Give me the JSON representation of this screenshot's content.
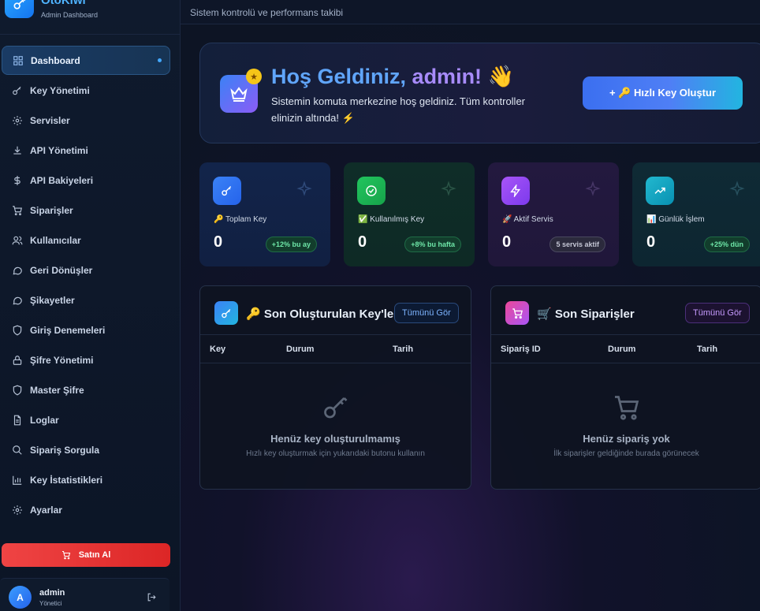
{
  "brand": {
    "name": "OtoKiwi",
    "subtitle": "Admin Dashboard"
  },
  "sidebar": {
    "items": [
      {
        "label": "Dashboard",
        "icon": "grid-icon",
        "active": true
      },
      {
        "label": "Key Yönetimi",
        "icon": "key-icon"
      },
      {
        "label": "Servisler",
        "icon": "gear-icon"
      },
      {
        "label": "API Yönetimi",
        "icon": "download-icon"
      },
      {
        "label": "API Bakiyeleri",
        "icon": "dollar-icon"
      },
      {
        "label": "Siparişler",
        "icon": "cart-icon"
      },
      {
        "label": "Kullanıcılar",
        "icon": "users-icon"
      },
      {
        "label": "Geri Dönüşler",
        "icon": "chat-icon"
      },
      {
        "label": "Şikayetler",
        "icon": "chat-icon"
      },
      {
        "label": "Giriş Denemeleri",
        "icon": "shield-icon"
      },
      {
        "label": "Şifre Yönetimi",
        "icon": "lock-icon"
      },
      {
        "label": "Master Şifre",
        "icon": "shield-icon"
      },
      {
        "label": "Loglar",
        "icon": "file-icon"
      },
      {
        "label": "Sipariş Sorgula",
        "icon": "search-icon"
      },
      {
        "label": "Key İstatistikleri",
        "icon": "bar-chart-icon"
      },
      {
        "label": "Ayarlar",
        "icon": "gear-icon"
      }
    ],
    "buy_label": "Satın Al",
    "user": {
      "initial": "A",
      "name": "admin",
      "role": "Yönetici"
    }
  },
  "header": {
    "subtitle": "Sistem kontrolü ve performans takibi"
  },
  "welcome": {
    "title_part1": "Hoş Geldiniz,",
    "title_part2": "admin!",
    "emoji": "👋",
    "description": "Sistemin komuta merkezine hoş geldiniz. Tüm kontroller elinizin altında! ⚡",
    "quick_button": "+     🔑 Hızlı Key Oluştur"
  },
  "stats": [
    {
      "label": "🔑 Toplam Key",
      "value": "0",
      "badge": "+12% bu ay"
    },
    {
      "label": "✅ Kullanılmış Key",
      "value": "0",
      "badge": "+8% bu hafta"
    },
    {
      "label": "🚀 Aktif Servis",
      "value": "0",
      "badge": "5 servis aktif"
    },
    {
      "label": "📊 Günlük İşlem",
      "value": "0",
      "badge": "+25% dün"
    }
  ],
  "keys_panel": {
    "title": "🔑 Son Oluşturulan Key'ler",
    "see_all": "Tümünü Gör",
    "columns": [
      "Key",
      "Durum",
      "Tarih"
    ],
    "empty_title": "Henüz key oluşturulmamış",
    "empty_sub": "Hızlı key oluşturmak için yukarıdaki butonu kullanın"
  },
  "orders_panel": {
    "title": "🛒 Son Siparişler",
    "see_all": "Tümünü Gör",
    "columns": [
      "Sipariş ID",
      "Durum",
      "Tarih"
    ],
    "empty_title": "Henüz sipariş yok",
    "empty_sub": "İlk siparişler geldiğinde burada görünecek"
  }
}
